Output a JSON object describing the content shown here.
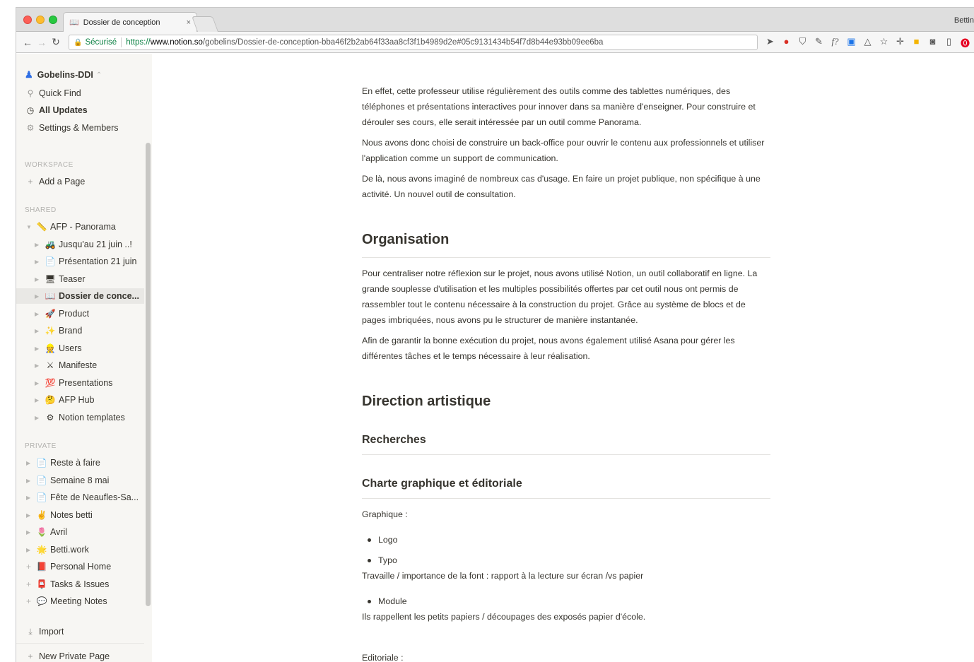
{
  "browser": {
    "tab_title": "Dossier de conception",
    "tab_icon": "book-icon",
    "profile": "Bettin",
    "secure_label": "Sécurisé",
    "url_scheme": "https://",
    "url_host": "www.notion.so",
    "url_path": "/gobelins/Dossier-de-conception-bba46f2b2ab64f33aa8cf3f1b4989d2e#05c9131434b54f7d8b44e93bb09ee6ba"
  },
  "sidebar": {
    "workspace": "Gobelins-DDI",
    "top_items": [
      {
        "icon": "search-icon",
        "label": "Quick Find"
      },
      {
        "icon": "clock-icon",
        "label": "All Updates"
      },
      {
        "icon": "gear-icon",
        "label": "Settings & Members"
      }
    ],
    "workspace_section": "WORKSPACE",
    "add_page": "Add a Page",
    "shared_section": "SHARED",
    "shared_root": {
      "emoji": "📏",
      "label": "AFP - Panorama"
    },
    "shared_children": [
      {
        "emoji": "🚜",
        "label": "Jusqu'au 21 juin ..!"
      },
      {
        "emoji": "📄",
        "label": "Présentation 21 juin"
      },
      {
        "emoji": "🖥",
        "label": "Teaser"
      },
      {
        "emoji": "📖",
        "label": "Dossier de conce..."
      },
      {
        "emoji": "🚀",
        "label": "Product"
      },
      {
        "emoji": "✨",
        "label": "Brand"
      },
      {
        "emoji": "👷",
        "label": "Users"
      },
      {
        "emoji": "⚔",
        "label": "Manifeste"
      },
      {
        "emoji": "💯",
        "label": "Presentations"
      },
      {
        "emoji": "🤔",
        "label": "AFP Hub"
      },
      {
        "emoji": "⚙",
        "label": "Notion templates"
      }
    ],
    "private_section": "PRIVATE",
    "private_items": [
      {
        "emoji": "📄",
        "label": "Reste à faire",
        "expand": "tri"
      },
      {
        "emoji": "📄",
        "label": "Semaine 8 mai",
        "expand": "tri"
      },
      {
        "emoji": "📄",
        "label": "Fête de Neaufles-Sa...",
        "expand": "tri"
      },
      {
        "emoji": "✌",
        "label": "Notes betti",
        "expand": "tri"
      },
      {
        "emoji": "🌷",
        "label": "Avril",
        "expand": "tri"
      },
      {
        "emoji": "🌟",
        "label": "Betti.work",
        "expand": "tri"
      },
      {
        "emoji": "📕",
        "label": "Personal Home",
        "expand": "plus"
      },
      {
        "emoji": "📮",
        "label": "Tasks & Issues",
        "expand": "plus"
      },
      {
        "emoji": "💬",
        "label": "Meeting Notes",
        "expand": "plus"
      }
    ],
    "import_label": "Import",
    "new_private_page": "New Private Page"
  },
  "content": {
    "para1": "En effet, cette professeur utilise régulièrement des outils comme des tablettes numériques, des téléphones et présentations interactives pour innover dans sa manière d'enseigner. Pour construire et dérouler ses cours, elle serait intéressée par un outil comme Panorama.",
    "para2": "Nous avons donc choisi de construire un back-office pour ouvrir le contenu aux professionnels et utiliser l'application comme un support de communication.",
    "para3": "De là, nous avons imaginé de nombreux cas d'usage. En faire un projet publique, non spécifique à une activité. Un nouvel outil de consultation.",
    "h_organisation": "Organisation",
    "para4": "Pour centraliser notre réflexion sur le projet, nous avons utilisé Notion, un outil collaboratif en ligne. La grande souplesse d'utilisation et les multiples possibilités offertes par cet outil nous ont permis de rassembler tout le contenu nécessaire à la construction du projet. Grâce au système de blocs et de pages imbriquées, nous avons pu le structurer de manière instantanée.",
    "para5": "Afin de garantir la bonne exécution du projet, nous avons également utilisé Asana pour gérer les différentes tâches et le temps nécessaire à leur réalisation.",
    "h_direction": "Direction artistique",
    "h_recherches": "Recherches",
    "h_charte": "Charte graphique et éditoriale",
    "graphique_label": "Graphique :",
    "bullet_logo": "Logo",
    "bullet_typo": "Typo",
    "travaille": "Travaille / importance de la font : rapport à la lecture sur écran /vs papier",
    "bullet_module": "Module",
    "rappellent": "Ils rappellent les petits papiers / découpages des exposés papier d'école.",
    "editoriale_label": "Editoriale :"
  }
}
